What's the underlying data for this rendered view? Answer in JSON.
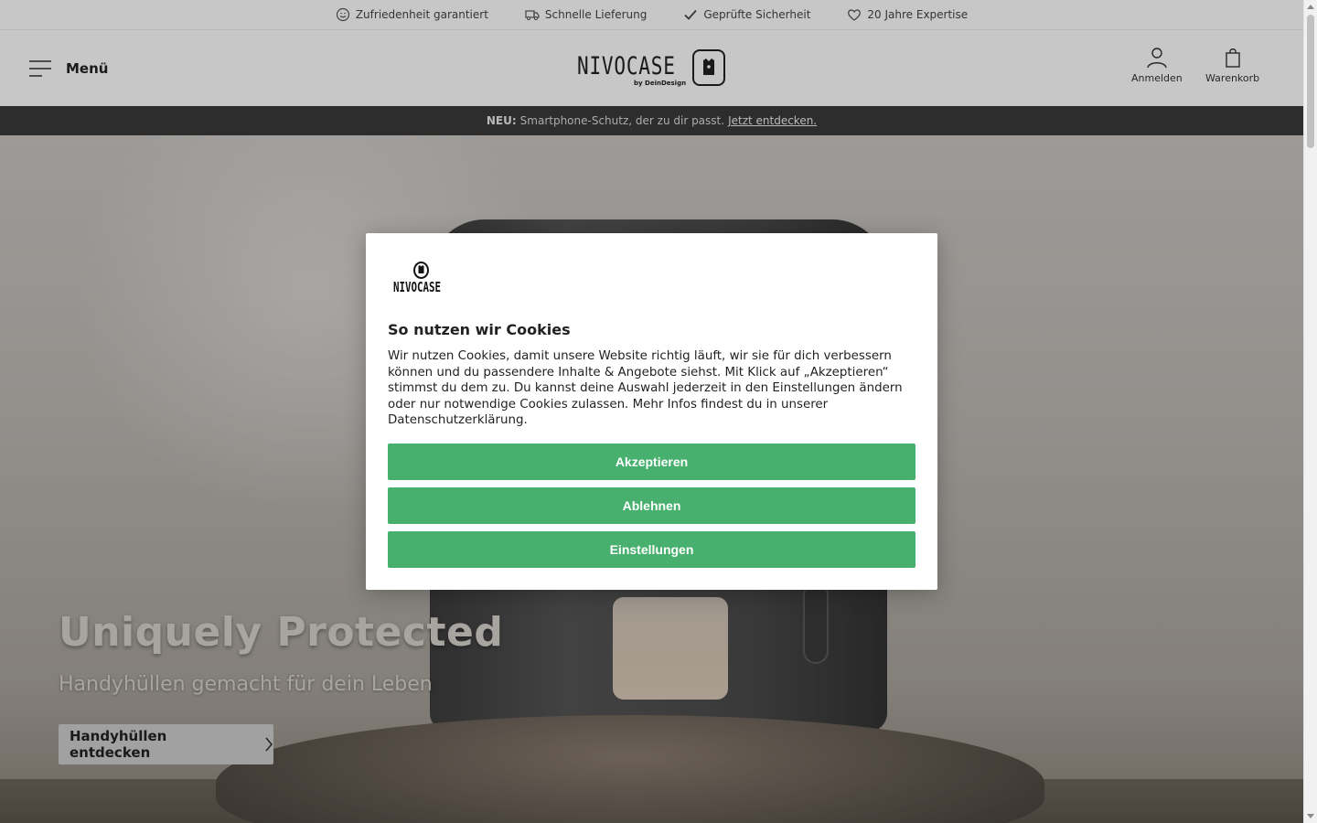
{
  "trust_bar": {
    "items": [
      {
        "label": "Zufriedenheit garantiert",
        "icon": "smiley-icon"
      },
      {
        "label": "Schnelle Lieferung",
        "icon": "truck-icon"
      },
      {
        "label": "Geprüfte Sicherheit",
        "icon": "check-icon"
      },
      {
        "label": "20 Jahre Expertise",
        "icon": "heart-icon"
      }
    ]
  },
  "header": {
    "menu_label": "Menü",
    "logo_text": "NIVOCASE",
    "logo_by": "by DeinDesign",
    "login_label": "Anmelden",
    "cart_label": "Warenkorb"
  },
  "announcement": {
    "prefix": "NEU:",
    "text": "Smartphone-Schutz, der zu dir passt.",
    "link": "Jetzt entdecken."
  },
  "hero": {
    "title": "Uniquely Protected",
    "subtitle": "Handyhüllen gemacht für dein Leben",
    "cta_label": "Handyhüllen entdecken"
  },
  "cookie_modal": {
    "logo_text": "NIVOCASE",
    "title": "So nutzen wir Cookies",
    "body": "Wir nutzen Cookies, damit unsere Website richtig läuft, wir sie für dich verbessern können und du passendere Inhalte & Angebote siehst. Mit Klick auf „Akzeptieren“ stimmst du dem zu. Du kannst deine Auswahl jederzeit in den Einstellungen ändern oder nur notwendige Cookies zulassen. Mehr Infos findest du in unserer Datenschutzerklärung.",
    "accept_label": "Akzeptieren",
    "reject_label": "Ablehnen",
    "settings_label": "Einstellungen",
    "button_color": "#48b06e"
  }
}
